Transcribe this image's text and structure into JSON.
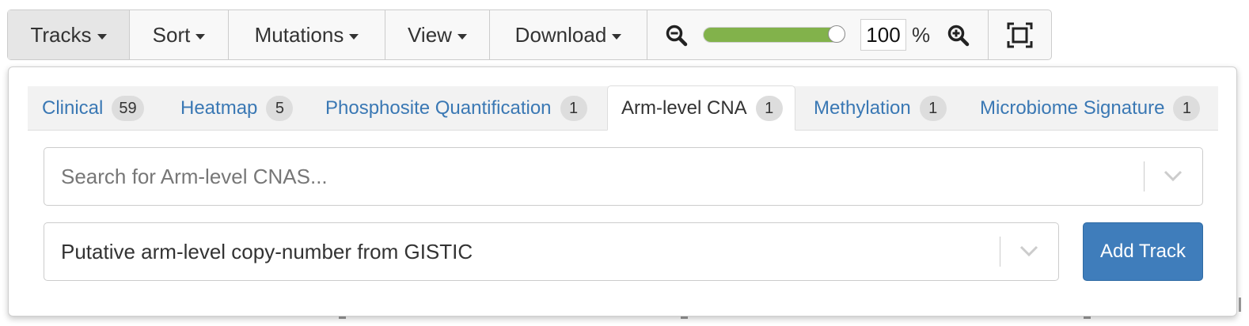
{
  "toolbar": {
    "menus": [
      {
        "label": "Tracks",
        "active": true
      },
      {
        "label": "Sort",
        "active": false
      },
      {
        "label": "Mutations",
        "active": false
      },
      {
        "label": "View",
        "active": false
      },
      {
        "label": "Download",
        "active": false
      }
    ],
    "zoom": {
      "value": "100",
      "unit": "%",
      "slider_fraction": 1.0,
      "zoom_out_icon": "zoom-out-icon",
      "zoom_in_icon": "zoom-in-icon",
      "fit_icon": "fit-to-screen-icon"
    }
  },
  "tracks_panel": {
    "tabs": [
      {
        "label": "Clinical",
        "count": "59",
        "active": false
      },
      {
        "label": "Heatmap",
        "count": "5",
        "active": false
      },
      {
        "label": "Phosphosite Quantification",
        "count": "1",
        "active": false
      },
      {
        "label": "Arm-level CNA",
        "count": "1",
        "active": true
      },
      {
        "label": "Methylation",
        "count": "1",
        "active": false
      },
      {
        "label": "Microbiome Signature",
        "count": "1",
        "active": false
      }
    ],
    "search": {
      "placeholder": "Search for Arm-level CNAS..."
    },
    "profile_select": {
      "value": "Putative arm-level copy-number from GISTIC"
    },
    "add_track_label": "Add Track"
  },
  "colors": {
    "link_blue": "#3a78b4",
    "primary_button": "#3f7dbb",
    "slider_fill": "#82b24b",
    "badge_bg": "#dddddd"
  }
}
